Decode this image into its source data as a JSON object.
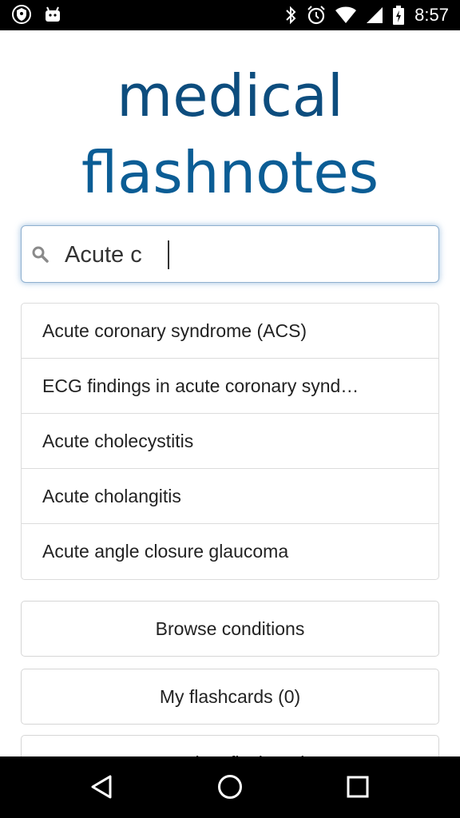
{
  "status_bar": {
    "time": "8:57",
    "left_icons": [
      "shield-icon",
      "android-icon"
    ],
    "right_icons": [
      "bluetooth-icon",
      "alarm-icon",
      "wifi-icon",
      "signal-icon",
      "battery-icon"
    ]
  },
  "logo": {
    "line1": "medical",
    "line2": "flashnotes"
  },
  "search": {
    "value": "Acute c",
    "placeholder": ""
  },
  "results": [
    {
      "label": "Acute coronary syndrome (ACS)"
    },
    {
      "label": "ECG findings in acute coronary synd…"
    },
    {
      "label": "Acute cholecystitis"
    },
    {
      "label": "Acute cholangitis"
    },
    {
      "label": "Acute angle closure glaucoma"
    }
  ],
  "actions": {
    "browse_label": "Browse conditions",
    "flashcards_label": "My flashcards (0)",
    "partial_label": "Random flashcard"
  },
  "nav": {
    "icons": [
      "back-icon",
      "home-icon",
      "recents-icon"
    ]
  },
  "colors": {
    "brand": "#0d4d7e",
    "brand_light": "#0b5d95",
    "focus_glow": "#6699cc"
  }
}
